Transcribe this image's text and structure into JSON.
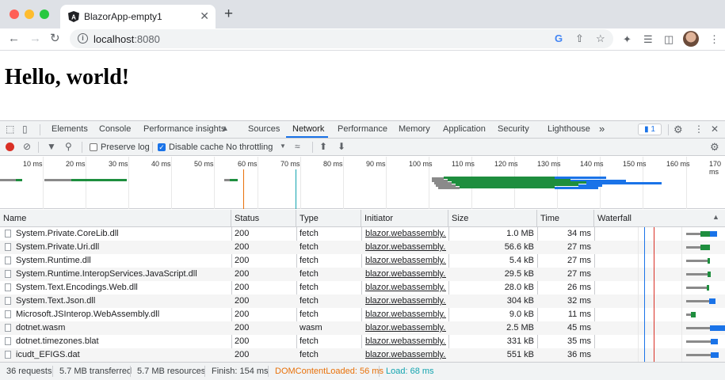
{
  "browser": {
    "tab_title": "BlazorApp-empty1",
    "tab_close": "✕",
    "new_tab": "+",
    "url_host": "localhost",
    "url_port": ":8080"
  },
  "page": {
    "heading": "Hello, world!"
  },
  "devtools": {
    "tabs": [
      "Elements",
      "Console",
      "Performance insights",
      "Sources",
      "Network",
      "Performance",
      "Memory",
      "Application",
      "Security",
      "Lighthouse"
    ],
    "active_tab": "Network",
    "more_tabs": "»",
    "issues_count": "1",
    "toolbar": {
      "preserve_log": "Preserve log",
      "preserve_log_checked": false,
      "disable_cache": "Disable cache",
      "disable_cache_checked": true,
      "throttling": "No throttling"
    },
    "overview_ticks": [
      "10 ms",
      "20 ms",
      "30 ms",
      "40 ms",
      "50 ms",
      "60 ms",
      "70 ms",
      "80 ms",
      "90 ms",
      "100 ms",
      "110 ms",
      "120 ms",
      "130 ms",
      "140 ms",
      "150 ms",
      "160 ms",
      "170 ms"
    ],
    "columns": [
      "Name",
      "Status",
      "Type",
      "Initiator",
      "Size",
      "Time",
      "Waterfall"
    ],
    "sort_indicator": "▲",
    "rows": [
      {
        "name": "System.Private.CoreLib.dll",
        "status": "200",
        "type": "fetch",
        "initiator": "blazor.webassembly...",
        "size": "1.0 MB",
        "time": "34 ms"
      },
      {
        "name": "System.Private.Uri.dll",
        "status": "200",
        "type": "fetch",
        "initiator": "blazor.webassembly...",
        "size": "56.6 kB",
        "time": "27 ms"
      },
      {
        "name": "System.Runtime.dll",
        "status": "200",
        "type": "fetch",
        "initiator": "blazor.webassembly...",
        "size": "5.4 kB",
        "time": "27 ms"
      },
      {
        "name": "System.Runtime.InteropServices.JavaScript.dll",
        "status": "200",
        "type": "fetch",
        "initiator": "blazor.webassembly...",
        "size": "29.5 kB",
        "time": "27 ms"
      },
      {
        "name": "System.Text.Encodings.Web.dll",
        "status": "200",
        "type": "fetch",
        "initiator": "blazor.webassembly...",
        "size": "28.0 kB",
        "time": "26 ms"
      },
      {
        "name": "System.Text.Json.dll",
        "status": "200",
        "type": "fetch",
        "initiator": "blazor.webassembly...",
        "size": "304 kB",
        "time": "32 ms"
      },
      {
        "name": "Microsoft.JSInterop.WebAssembly.dll",
        "status": "200",
        "type": "fetch",
        "initiator": "blazor.webassembly...",
        "size": "9.0 kB",
        "time": "11 ms"
      },
      {
        "name": "dotnet.wasm",
        "status": "200",
        "type": "wasm",
        "initiator": "blazor.webassembly...",
        "size": "2.5 MB",
        "time": "45 ms"
      },
      {
        "name": "dotnet.timezones.blat",
        "status": "200",
        "type": "fetch",
        "initiator": "blazor.webassembly...",
        "size": "331 kB",
        "time": "35 ms"
      },
      {
        "name": "icudt_EFIGS.dat",
        "status": "200",
        "type": "fetch",
        "initiator": "blazor.webassembly...",
        "size": "551 kB",
        "time": "36 ms"
      }
    ],
    "status_bar": {
      "requests": "36 requests",
      "transferred": "5.7 MB transferred",
      "resources": "5.7 MB resources",
      "finish": "Finish: 154 ms",
      "dom_content_loaded": "DOMContentLoaded: 56 ms",
      "load": "Load: 68 ms"
    }
  },
  "colors": {
    "accent": "#1a73e8",
    "record": "#d93025",
    "dom_content_loaded": "#e8710a",
    "load": "#12a4af",
    "waterfall_wait": "#8a8a8a",
    "waterfall_green": "#1e8e3e",
    "waterfall_blue": "#1a73e8"
  },
  "icons": [
    "angular-icon",
    "back-arrow-icon",
    "forward-arrow-icon",
    "reload-icon",
    "info-icon",
    "google-icon",
    "share-icon",
    "star-icon",
    "extensions-icon",
    "media-icon",
    "sidepanel-icon",
    "more-vert-icon",
    "inspect-icon",
    "device-toggle-icon",
    "record-icon",
    "clear-icon",
    "filter-icon",
    "search-icon",
    "network-conditions-icon",
    "upload-icon",
    "download-icon",
    "gear-icon",
    "close-icon"
  ]
}
